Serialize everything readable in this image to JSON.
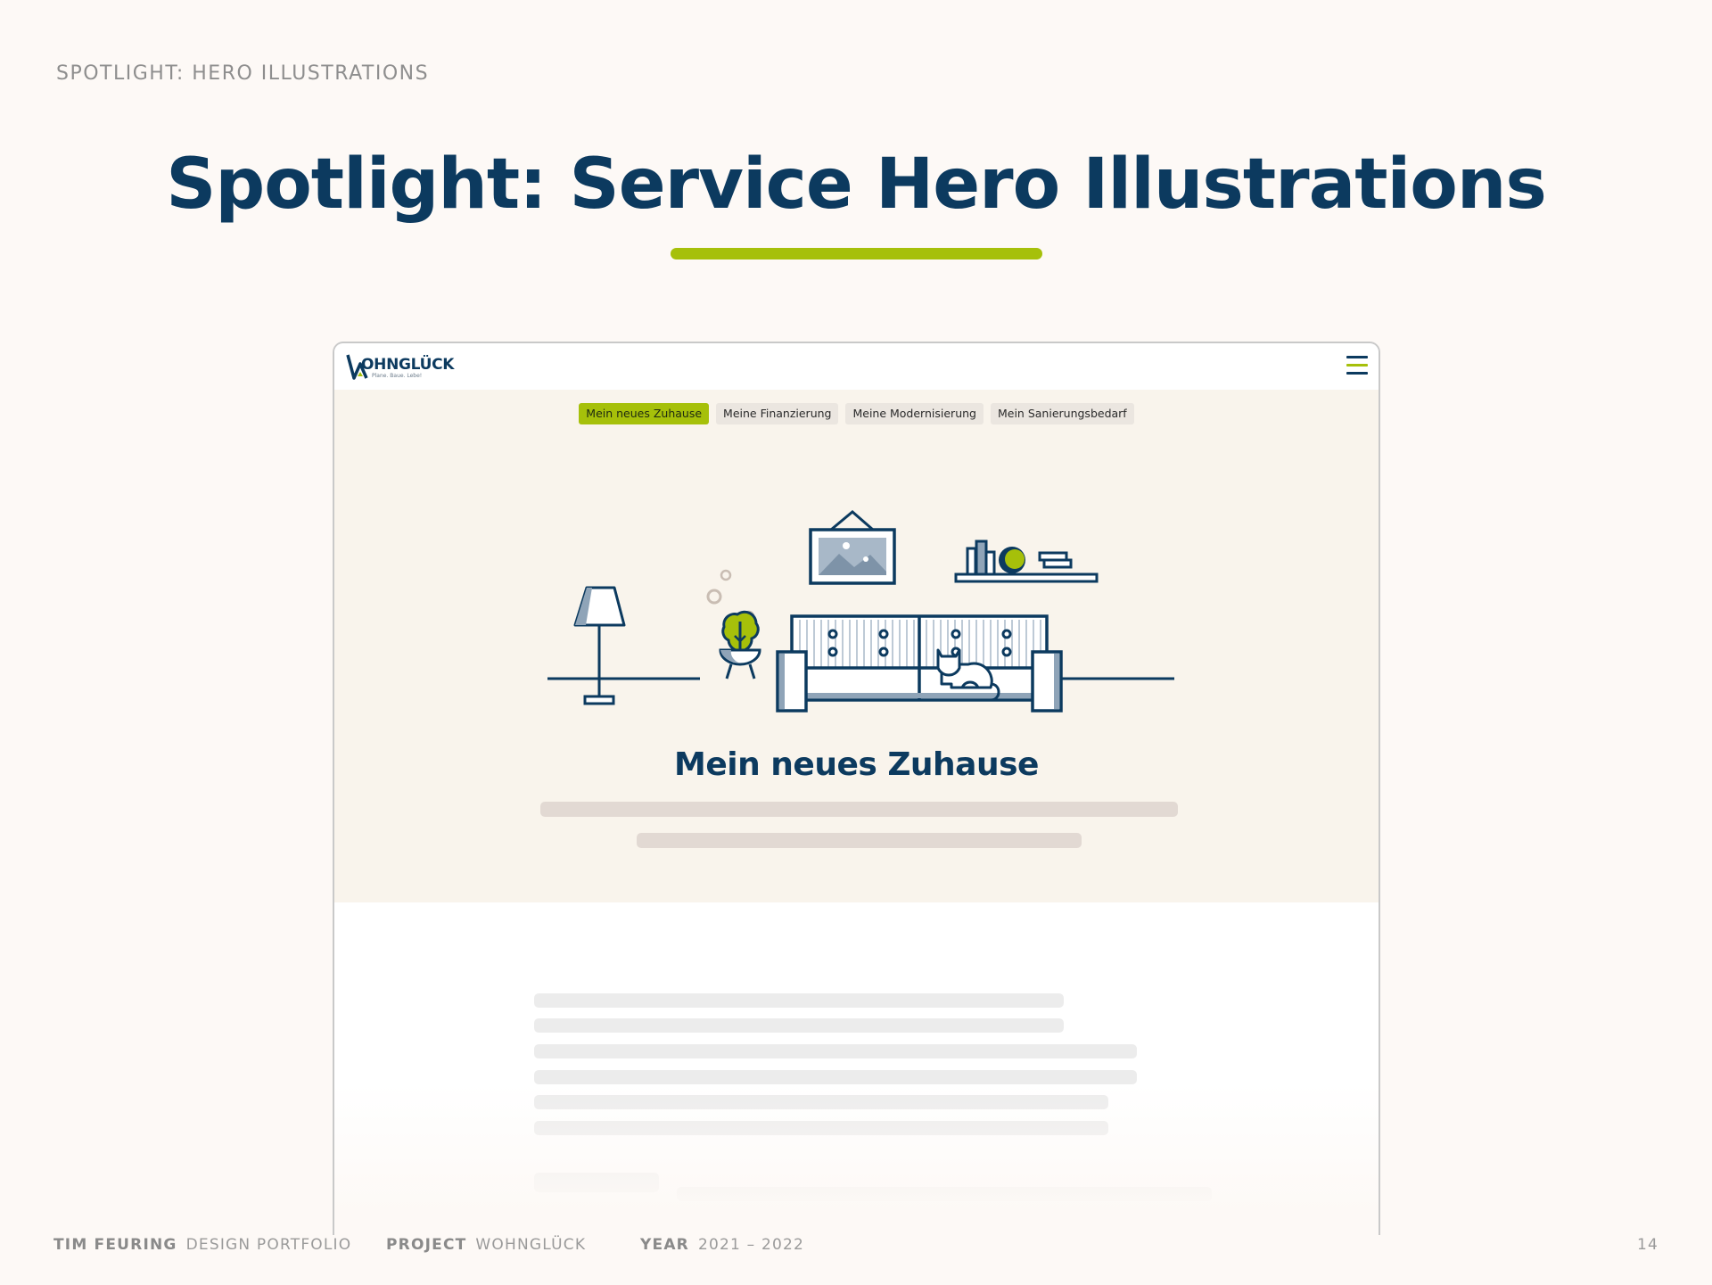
{
  "slide": {
    "eyebrow": "SPOTLIGHT: HERO ILLUSTRATIONS",
    "title": "Spotlight: Service Hero Illustrations"
  },
  "site": {
    "logo_text": "OHNGLÜCK",
    "logo_tagline": "Plane. Baue. Lebe!",
    "menu_icon": "hamburger-menu-icon",
    "tabs": [
      {
        "label": "Mein neues Zuhause",
        "active": true
      },
      {
        "label": "Meine Finanzierung",
        "active": false
      },
      {
        "label": "Meine Modernisierung",
        "active": false
      },
      {
        "label": "Mein Sanierungsbedarf",
        "active": false
      }
    ],
    "hero_heading": "Mein neues Zuhause",
    "illustration_icons": [
      "floor-lamp-icon",
      "plant-icon",
      "framed-picture-icon",
      "bookshelf-icon",
      "sofa-icon",
      "cat-icon"
    ]
  },
  "footer": {
    "author_label": "TIM FEURING",
    "author_value": "DESIGN PORTFOLIO",
    "project_label": "PROJECT",
    "project_value": "WOHNGLÜCK",
    "year_label": "YEAR",
    "year_value": "2021 – 2022",
    "page_number": "14"
  },
  "colors": {
    "navy": "#0c3a5f",
    "accent_green": "#a6c00a",
    "hero_bg": "#f9f4ec",
    "page_bg": "#fdf9f6"
  }
}
